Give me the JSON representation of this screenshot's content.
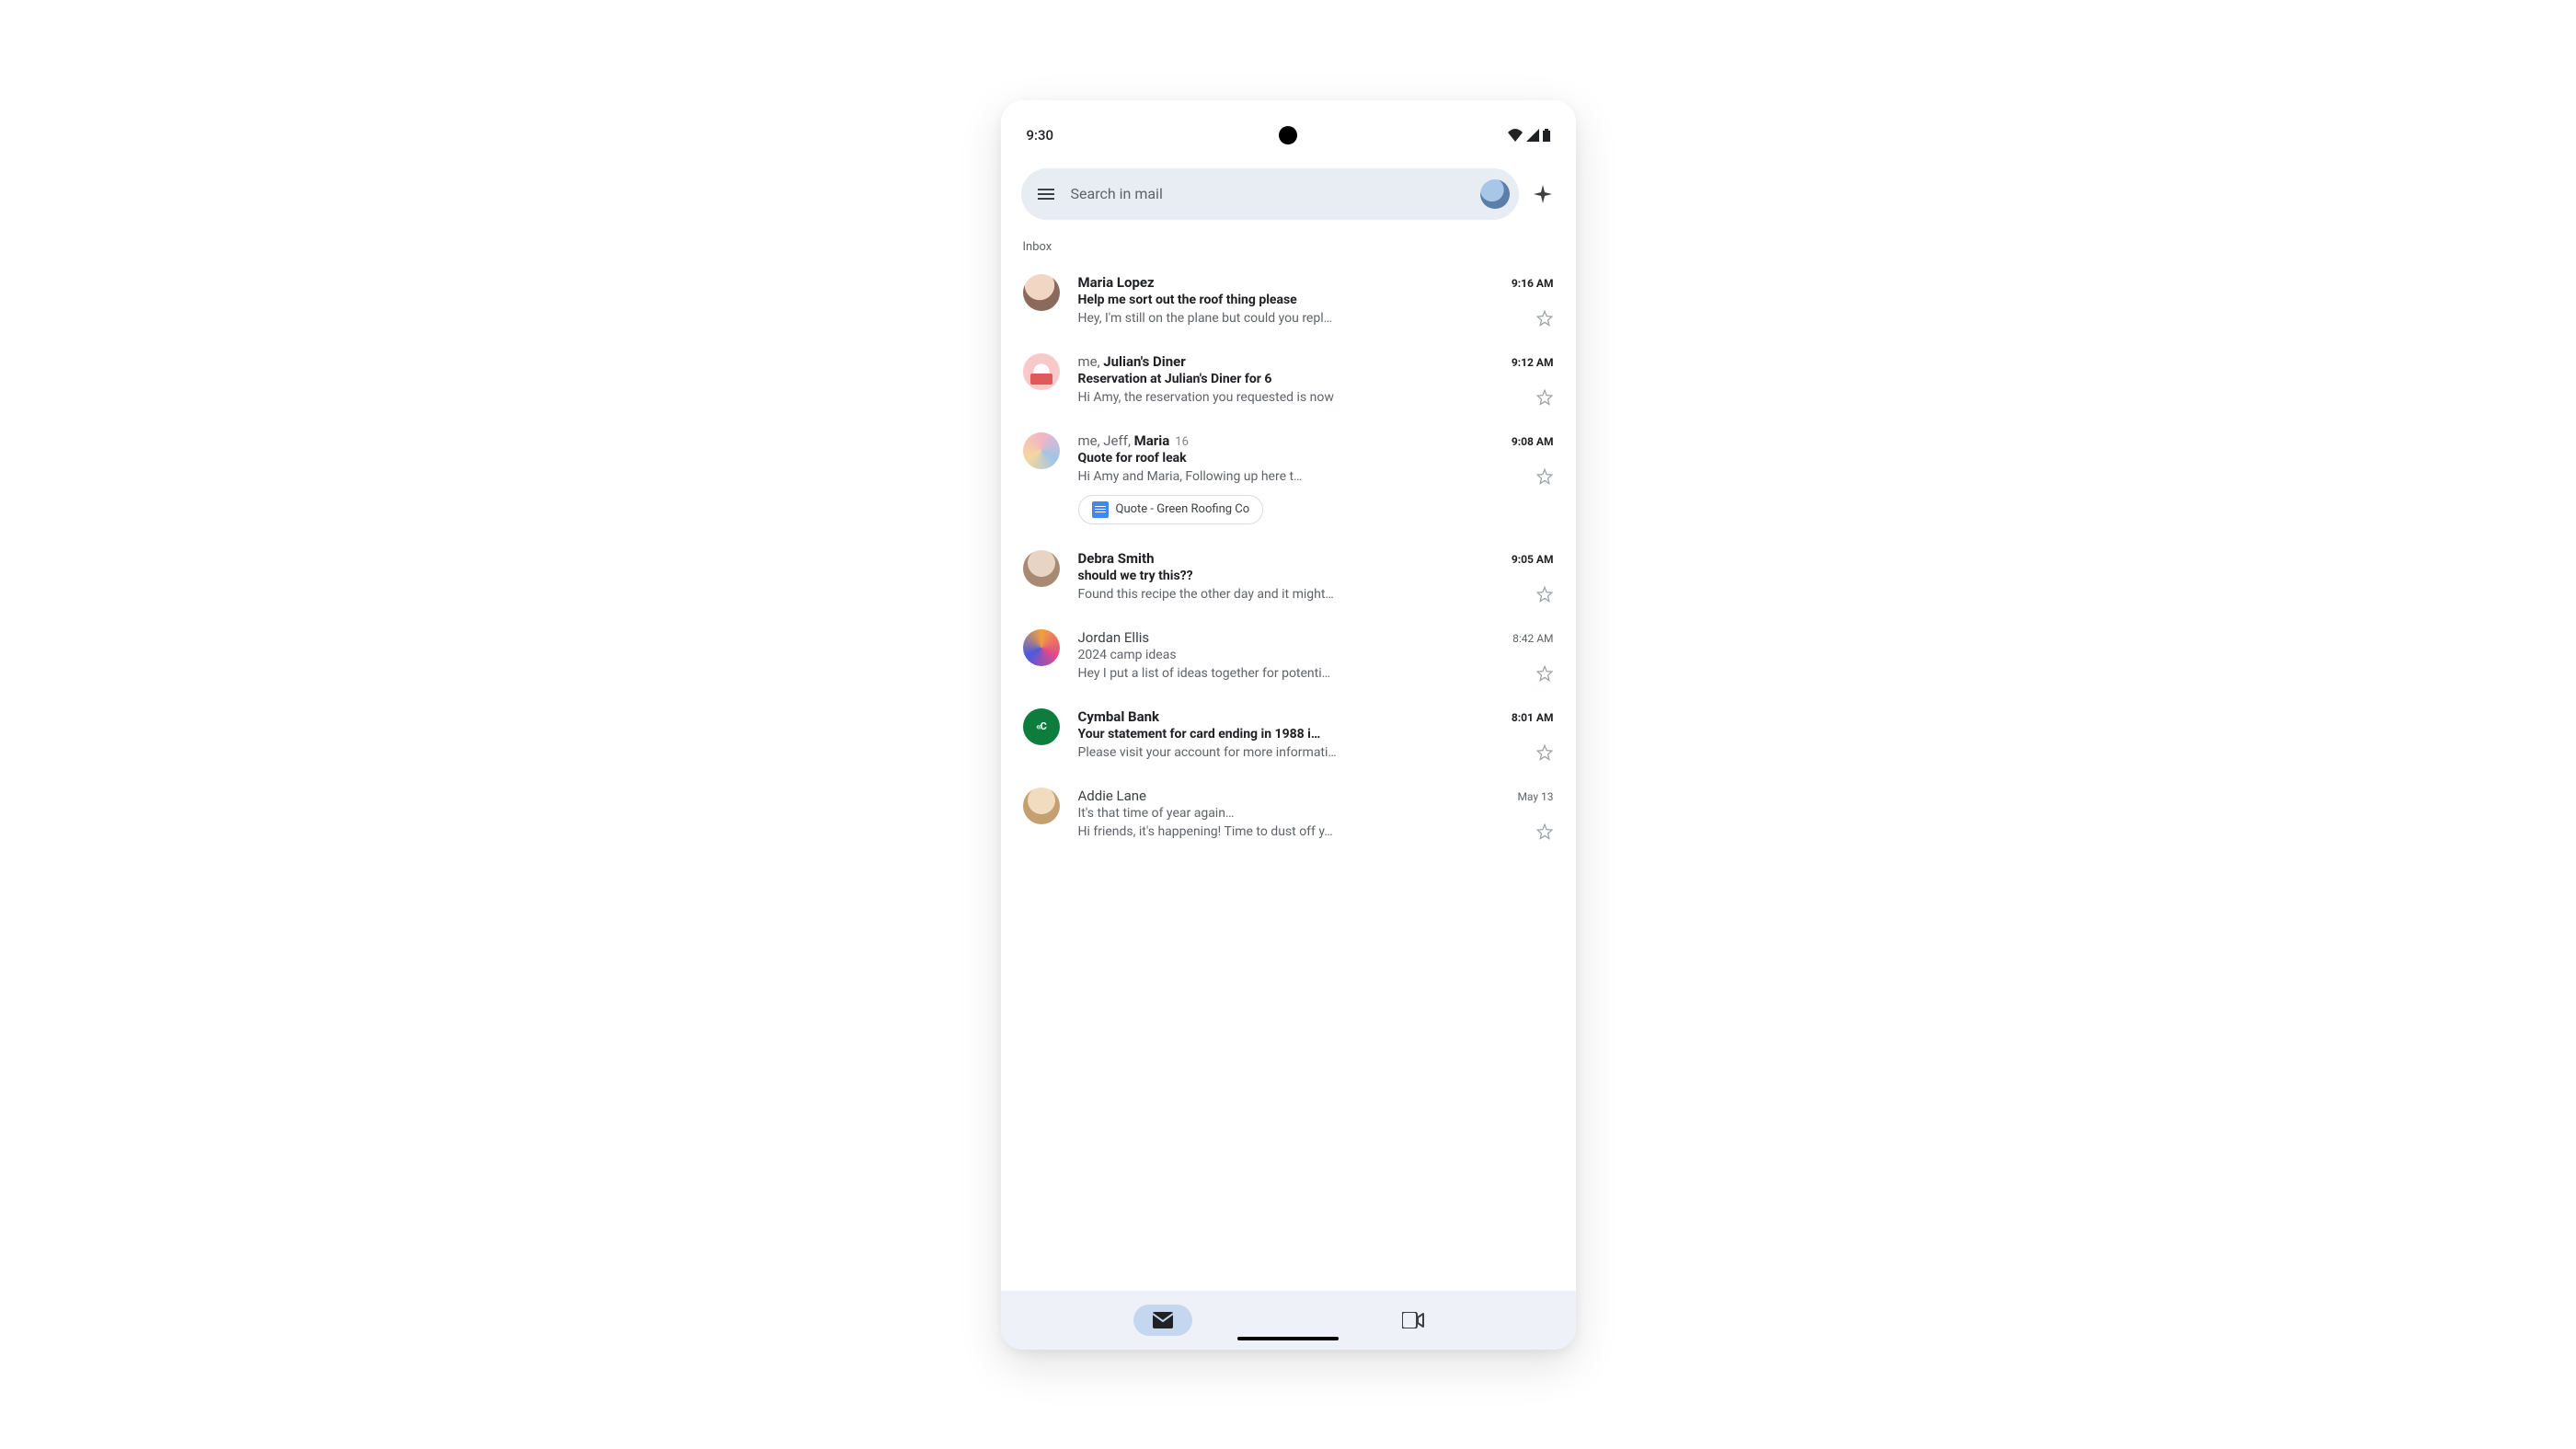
{
  "status": {
    "time": "9:30"
  },
  "search": {
    "placeholder": "Search in mail"
  },
  "section_label": "Inbox",
  "emails": [
    {
      "sender_html": "Maria Lopez",
      "unread": true,
      "time": "9:16 AM",
      "subject": "Help me sort out the roof thing please",
      "snippet": "Hey, I'm still on the plane but could you repl…",
      "avatar_class": "av-maria"
    },
    {
      "sender_prefix": "me, ",
      "sender_bold": "Julian's Diner",
      "unread": true,
      "time": "9:12 AM",
      "subject": "Reservation at Julian's Diner for 6",
      "snippet": "Hi Amy, the reservation you requested is now",
      "avatar_class": "av-diner"
    },
    {
      "sender_prefix": "me, Jeff, ",
      "sender_bold": "Maria",
      "count": "16",
      "unread": true,
      "time": "9:08 AM",
      "subject": "Quote for roof leak",
      "snippet": "Hi Amy and Maria, Following up here t…",
      "avatar_class": "av-thread",
      "chip": "Quote - Green Roofing Co"
    },
    {
      "sender_html": "Debra Smith",
      "unread": true,
      "time": "9:05 AM",
      "subject": "should we try this??",
      "snippet": "Found this recipe the other day and it might…",
      "avatar_class": "av-debra"
    },
    {
      "sender_html": "Jordan Ellis",
      "unread": false,
      "time": "8:42 AM",
      "subject": "2024 camp ideas",
      "snippet": "Hey I put a list of ideas together for potenti…",
      "avatar_class": "av-jordan"
    },
    {
      "sender_html": "Cymbal Bank",
      "unread": true,
      "time": "8:01 AM",
      "subject": "Your statement for card ending in 1988 i…",
      "snippet": "Please visit your account for more informati…",
      "avatar_class": "av-cymbal",
      "avatar_text": "«C"
    },
    {
      "sender_html": "Addie Lane",
      "unread": false,
      "time": "May 13",
      "subject": "It's that time of year again…",
      "snippet": "Hi friends, it's happening! Time to dust off y…",
      "avatar_class": "av-addie"
    }
  ]
}
